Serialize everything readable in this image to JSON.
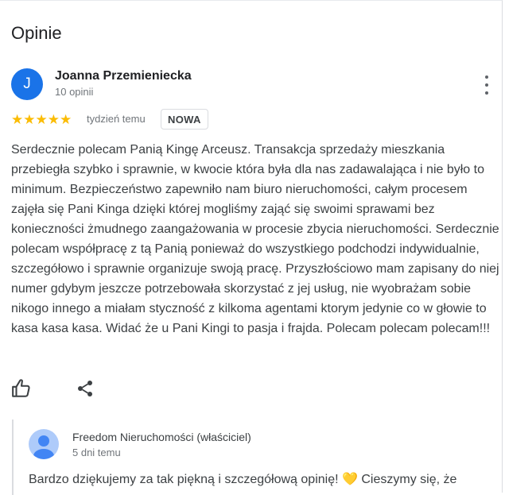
{
  "section": {
    "title": "Opinie"
  },
  "review": {
    "avatar_letter": "J",
    "author": "Joanna Przemieniecka",
    "author_meta": "10 opinii",
    "stars": "★★★★★",
    "rating": 5,
    "time": "tydzień temu",
    "badge": "NOWA",
    "text": "Serdecznie polecam Panią Kingę Arceusz. Transakcja sprzedaży mieszkania przebiegła szybko i sprawnie, w kwocie która była dla nas zadawalająca i nie było to minimum. Bezpieczeństwo zapewniło nam biuro nieruchomości, całym procesem zajęła się Pani Kinga dzięki której mogliśmy zająć się swoimi sprawami bez konieczności żmudnego zaangażowania w procesie zbycia nieruchomości. Serdecznie polecam współpracę z tą Panią ponieważ do wszystkiego podchodzi indywidualnie, szczegółowo i sprawnie organizuje swoją pracę. Przyszłościowo mam zapisany do niej numer gdybym jeszcze potrzebowała skorzystać z jej usług, nie wyobrażam sobie nikogo innego a miałam styczność z kilkoma agentami ktorym jedynie co w głowie to kasa kasa kasa. Widać że u Pani Kingi to pasja i frajda. Polecam polecam polecam!!!"
  },
  "owner_reply": {
    "author": "Freedom Nieruchomości (właściciel)",
    "time": "5 dni temu",
    "text": "Bardzo dziękujemy za tak piękną i szczegółową opinię! 💛 Cieszymy się, że"
  },
  "colors": {
    "avatar": "#1a73e8",
    "stars": "#fbbc04",
    "owner_avatar_bg": "#aecbfa",
    "owner_avatar_fg": "#4285f4"
  },
  "icons": {
    "more": "more-vertical-icon",
    "like": "thumbs-up-icon",
    "share": "share-icon",
    "owner": "person-icon"
  }
}
